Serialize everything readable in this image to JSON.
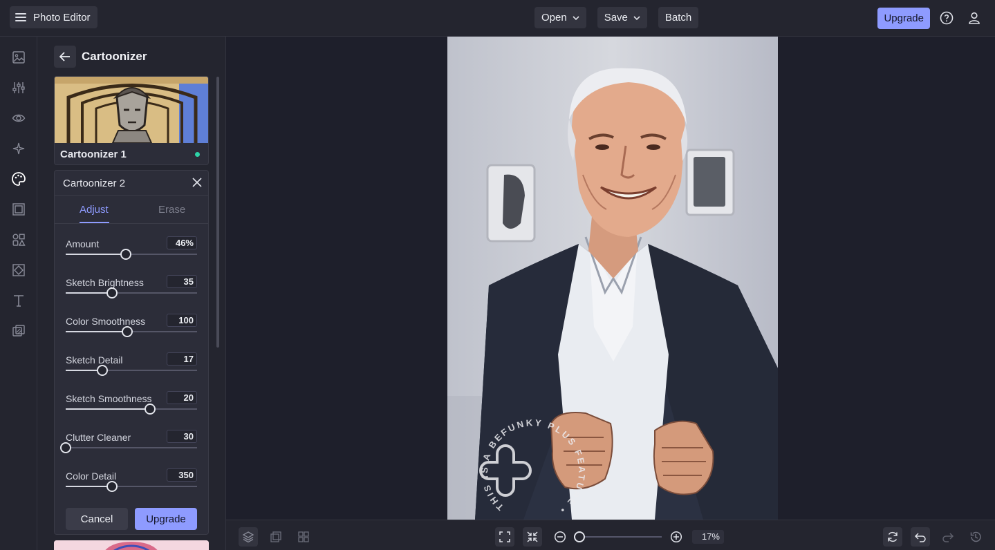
{
  "header": {
    "app_title": "Photo Editor",
    "menu": [
      "Open",
      "Save",
      "Batch"
    ],
    "upgrade_label": "Upgrade"
  },
  "rail": {
    "icons": [
      "image-icon",
      "adjust-sliders-icon",
      "eye-icon",
      "magic-sparkle-icon",
      "palette-icon",
      "frame-icon",
      "graphics-icon",
      "texture-icon",
      "text-icon",
      "overlay-icon"
    ],
    "active": "palette-icon"
  },
  "panel": {
    "title": "Cartoonizer",
    "preset": {
      "name": "Cartoonizer 1",
      "status_color": "#2ed3a8"
    },
    "adjust": {
      "title": "Cartoonizer 2",
      "tabs": [
        "Adjust",
        "Erase"
      ],
      "active_tab": "Adjust",
      "sliders": [
        {
          "label": "Amount",
          "value": "46%",
          "fraction": 0.46
        },
        {
          "label": "Sketch Brightness",
          "value": "35",
          "fraction": 0.35
        },
        {
          "label": "Color Smoothness",
          "value": "100",
          "fraction": 0.47
        },
        {
          "label": "Sketch Detail",
          "value": "17",
          "fraction": 0.28
        },
        {
          "label": "Sketch Smoothness",
          "value": "20",
          "fraction": 0.64
        },
        {
          "label": "Clutter Cleaner",
          "value": "30",
          "fraction": 0.0
        },
        {
          "label": "Color Detail",
          "value": "350",
          "fraction": 0.35
        }
      ],
      "cancel_label": "Cancel",
      "upgrade_label": "Upgrade"
    }
  },
  "canvas": {
    "watermark_text": "THIS IS A BEFUNKY PLUS FEATURE •"
  },
  "footer": {
    "zoom_value": "17%",
    "zoom_fraction": 0.05
  },
  "colors": {
    "accent": "#8e9bff",
    "background": "#1e1f2b",
    "panel": "#24252f"
  }
}
